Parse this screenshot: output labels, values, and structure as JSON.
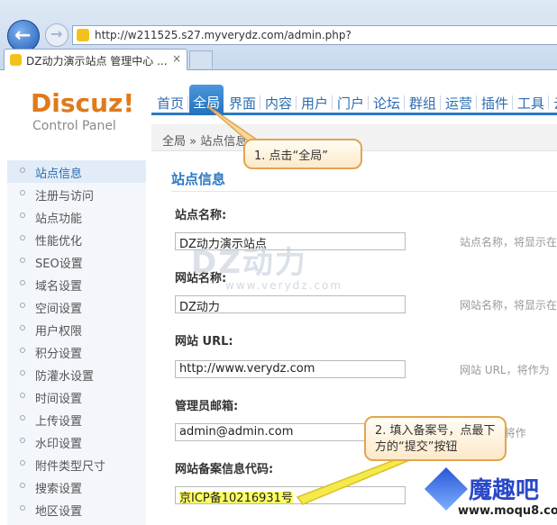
{
  "browser": {
    "url": "http://w211525.s27.myverydz.com/admin.php?",
    "tab_title": "DZ动力演示站点 管理中心 ...",
    "tab_close": "×"
  },
  "header": {
    "logo_text": "Discuz!",
    "logo_subtitle": "Control Panel",
    "nav": [
      "首页",
      "全局",
      "界面",
      "内容",
      "用户",
      "门户",
      "论坛",
      "群组",
      "运营",
      "插件",
      "工具",
      "云"
    ],
    "active_nav_index": 1,
    "breadcrumb": "全局 » 站点信息"
  },
  "sidebar": {
    "items": [
      "站点信息",
      "注册与访问",
      "站点功能",
      "性能优化",
      "SEO设置",
      "域名设置",
      "空间设置",
      "用户权限",
      "积分设置",
      "防灌水设置",
      "时间设置",
      "上传设置",
      "水印设置",
      "附件类型尺寸",
      "搜索设置",
      "地区设置"
    ],
    "active_index": 0
  },
  "main": {
    "section_title": "站点信息",
    "fields": [
      {
        "label": "站点名称:",
        "value": "DZ动力演示站点",
        "hint": "站点名称，将显示在"
      },
      {
        "label": "网站名称:",
        "value": "DZ动力",
        "hint": "网站名称，将显示在"
      },
      {
        "label": "网站 URL:",
        "value": "http://www.verydz.com",
        "hint": "网站 URL，将作为"
      },
      {
        "label": "管理员邮箱:",
        "value": "admin@admin.com",
        "hint": "E-mail，将作"
      },
      {
        "label": "网站备案信息代码:",
        "value": "京ICP备10216931号",
        "hint": ""
      }
    ]
  },
  "overlay": {
    "watermark": "DZ动力",
    "watermark_url": "www.verydz.com",
    "callout1": "1. 点击“全局”",
    "callout2": "2. 填入备案号，点最下方的“提交”按钮",
    "corner_logo": "魔趣吧",
    "corner_url": "www.moqu8.com",
    "highlight_color": "#ffff66",
    "accent_color": "#2b7ac4"
  }
}
